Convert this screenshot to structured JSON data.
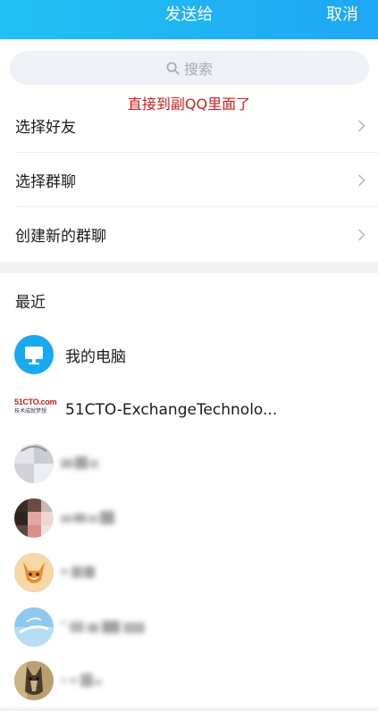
{
  "header": {
    "title": "发送给",
    "cancel_label": "取消"
  },
  "search": {
    "placeholder": "搜索"
  },
  "annotation": "直接到副QQ里面了",
  "menu": {
    "items": [
      {
        "label": "选择好友"
      },
      {
        "label": "选择群聊"
      },
      {
        "label": "创建新的群聊"
      }
    ]
  },
  "recent": {
    "title": "最近",
    "items": [
      {
        "name": "我的电脑",
        "icon": "computer-icon"
      },
      {
        "name": "51CTO-ExchangeTechnolo...",
        "logo_text": "51CTO.com",
        "logo_subtext": "技术成就梦想"
      }
    ]
  },
  "colors": {
    "header_start": "#22c1f2",
    "header_end": "#1ea7f3",
    "annotation": "#d42020",
    "computer_avatar": "#19a9f0"
  }
}
